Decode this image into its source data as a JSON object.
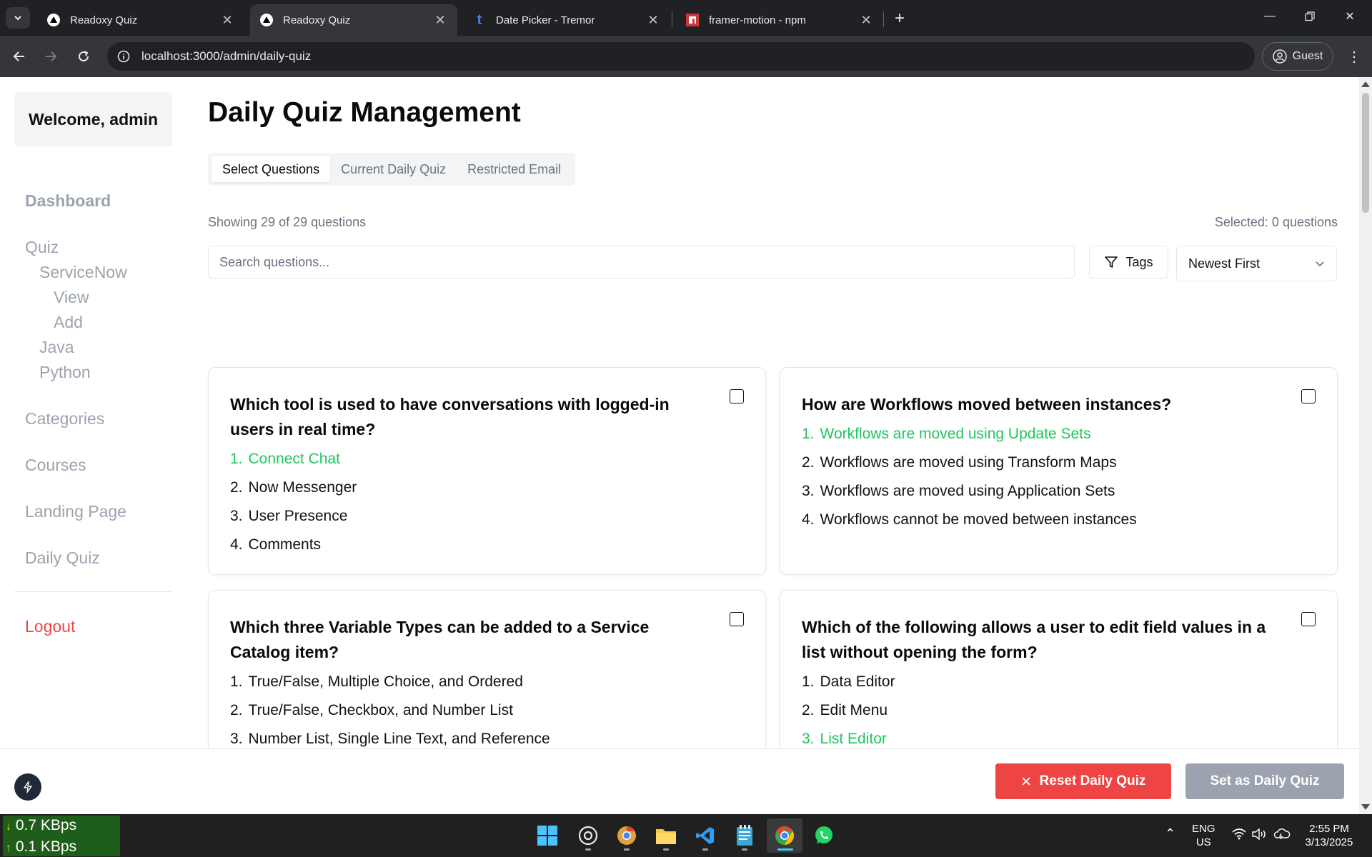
{
  "browser": {
    "tabs": [
      {
        "title": "Readoxy Quiz",
        "icon": "readoxy-favicon",
        "active": false
      },
      {
        "title": "Readoxy Quiz",
        "icon": "readoxy-favicon",
        "active": true
      },
      {
        "title": "Date Picker - Tremor",
        "icon": "tremor-favicon",
        "active": false
      },
      {
        "title": "framer-motion - npm",
        "icon": "npm-favicon",
        "active": false
      }
    ],
    "url": "localhost:3000/admin/daily-quiz",
    "profile_label": "Guest"
  },
  "sidebar": {
    "welcome": "Welcome, admin",
    "dashboard": "Dashboard",
    "quiz": "Quiz",
    "servicenow": "ServiceNow",
    "view": "View",
    "add": "Add",
    "java": "Java",
    "python": "Python",
    "categories": "Categories",
    "courses": "Courses",
    "landing_page": "Landing Page",
    "daily_quiz": "Daily Quiz",
    "logout": "Logout"
  },
  "main": {
    "title": "Daily Quiz Management",
    "tabs": [
      {
        "label": "Select Questions",
        "active": true
      },
      {
        "label": "Current Daily Quiz",
        "active": false
      },
      {
        "label": "Restricted Email",
        "active": false
      }
    ],
    "showing": "Showing 29 of 29 questions",
    "selected": "Selected: 0 questions",
    "search_placeholder": "Search questions...",
    "tags_label": "Tags",
    "sort_value": "Newest First"
  },
  "questions": [
    {
      "question": "Which tool is used to have conversations with logged-in users in real time?",
      "options": [
        {
          "num": "1.",
          "text": "Connect Chat",
          "correct": true
        },
        {
          "num": "2.",
          "text": "Now Messenger",
          "correct": false
        },
        {
          "num": "3.",
          "text": "User Presence",
          "correct": false
        },
        {
          "num": "4.",
          "text": "Comments",
          "correct": false
        }
      ]
    },
    {
      "question": "How are Workflows moved between instances?",
      "options": [
        {
          "num": "1.",
          "text": "Workflows are moved using Update Sets",
          "correct": true
        },
        {
          "num": "2.",
          "text": "Workflows are moved using Transform Maps",
          "correct": false
        },
        {
          "num": "3.",
          "text": "Workflows are moved using Application Sets",
          "correct": false
        },
        {
          "num": "4.",
          "text": "Workflows cannot be moved between instances",
          "correct": false
        }
      ]
    },
    {
      "question": "Which three Variable Types can be added to a Service Catalog item?",
      "options": [
        {
          "num": "1.",
          "text": "True/False, Multiple Choice, and Ordered",
          "correct": false
        },
        {
          "num": "2.",
          "text": "True/False, Checkbox, and Number List",
          "correct": false
        },
        {
          "num": "3.",
          "text": "Number List, Single Line Text, and Reference",
          "correct": false
        }
      ]
    },
    {
      "question": "Which of the following allows a user to edit field values in a list without opening the form?",
      "options": [
        {
          "num": "1.",
          "text": "Data Editor",
          "correct": false
        },
        {
          "num": "2.",
          "text": "Edit Menu",
          "correct": false
        },
        {
          "num": "3.",
          "text": "List Editor",
          "correct": true
        }
      ]
    }
  ],
  "actions": {
    "reset": "Reset Daily Quiz",
    "set": "Set as Daily Quiz"
  },
  "colors": {
    "accent_red": "#ef4444",
    "correct_green": "#22c55e",
    "disabled_gray": "#9ca3af"
  },
  "taskbar": {
    "net_down": "0.7 KBps",
    "net_up": "0.1 KBps",
    "lang_line1": "ENG",
    "lang_line2": "US",
    "time": "2:55 PM",
    "date": "3/13/2025",
    "apps": [
      "windows-start-icon",
      "chatgpt-icon",
      "chrome-canary-icon",
      "file-explorer-icon",
      "vscode-icon",
      "notepad-icon",
      "chrome-icon",
      "whatsapp-icon"
    ]
  }
}
